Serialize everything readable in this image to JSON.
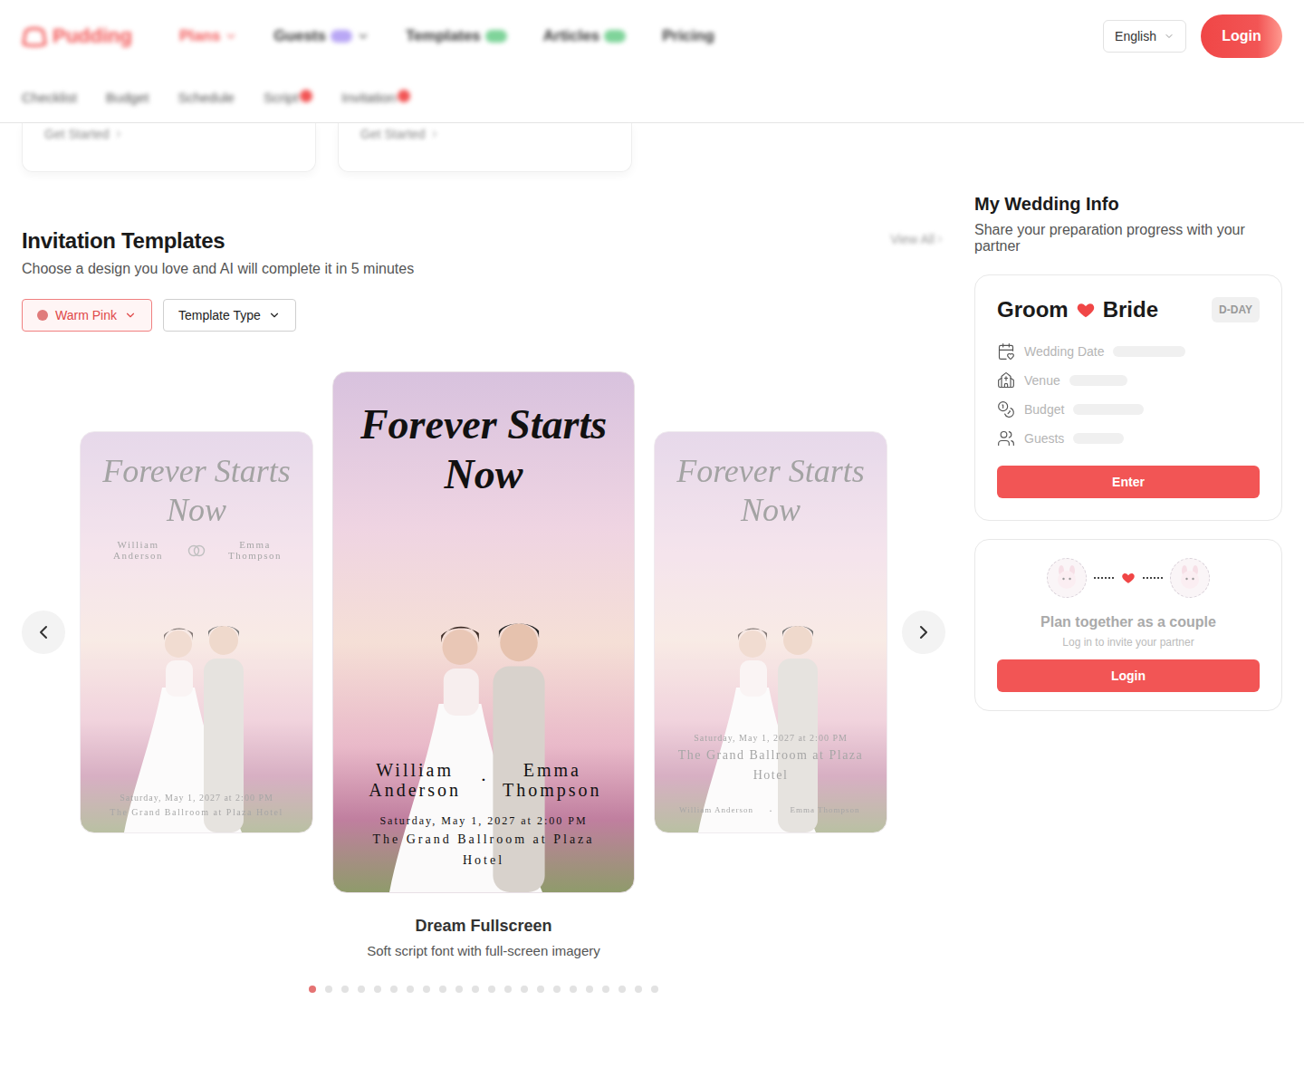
{
  "header": {
    "logo": "Pudding",
    "nav": [
      {
        "label": "Plans",
        "selected": true,
        "badge": false,
        "badge_color": "",
        "dropdown": true
      },
      {
        "label": "Guests",
        "selected": false,
        "badge": true,
        "badge_color": "#b9a7f5",
        "dropdown": true
      },
      {
        "label": "Templates",
        "selected": false,
        "badge": true,
        "badge_color": "#7fd49a",
        "dropdown": false
      },
      {
        "label": "Articles",
        "selected": false,
        "badge": true,
        "badge_color": "#7fd49a",
        "dropdown": false
      },
      {
        "label": "Pricing",
        "selected": false,
        "badge": false,
        "badge_color": "",
        "dropdown": false
      }
    ],
    "subnav": [
      {
        "label": "Checklist",
        "dot": false
      },
      {
        "label": "Budget",
        "dot": false
      },
      {
        "label": "Schedule",
        "dot": false
      },
      {
        "label": "Script",
        "dot": true
      },
      {
        "label": "Invitation",
        "dot": true
      }
    ],
    "language": "English",
    "login": "Login"
  },
  "feature_cards": [
    {
      "link": "Get Started"
    },
    {
      "link": "Get Started"
    }
  ],
  "invitations": {
    "title": "Invitation Templates",
    "subtitle": "Choose a design you love and AI will complete it in 5 minutes",
    "view_all": "View All",
    "filters": [
      {
        "label": "Warm Pink",
        "selected": true,
        "color": "#e07b7b"
      },
      {
        "label": "Template Type",
        "selected": false,
        "color": ""
      }
    ],
    "templates": [
      {
        "kind": "classic",
        "selected": false,
        "title": "Forever Starts Now",
        "groom": "William Anderson",
        "bride": "Emma Thompson",
        "separator": "",
        "date": "Saturday, May 1, 2027 at 2:00 PM",
        "venue": "The Grand Ballroom at Plaza Hotel"
      },
      {
        "kind": "fullscreen",
        "selected": true,
        "title": "Forever Starts Now",
        "groom": "William Anderson",
        "bride": "Emma Thompson",
        "separator": "·",
        "date": "Saturday, May 1, 2027 at 2:00 PM",
        "venue": "The Grand Ballroom at Plaza Hotel"
      },
      {
        "kind": "frame",
        "selected": false,
        "title": "Forever Starts Now",
        "groom": "William Anderson",
        "bride": "Emma Thompson",
        "separator": "·",
        "date": "Saturday, May 1, 2027 at 2:00 PM",
        "venue": "The Grand Ballroom at Plaza Hotel"
      }
    ],
    "caption": {
      "title": "Dream Fullscreen",
      "subtitle": "Soft script font with full-screen imagery"
    },
    "dots": [
      true,
      false,
      false,
      false,
      false,
      false,
      false,
      false,
      false,
      false,
      false,
      false,
      false,
      false,
      false,
      false,
      false,
      false,
      false,
      false,
      false,
      false
    ]
  },
  "wedding_info": {
    "title": "My Wedding Info",
    "subtitle": "Share your preparation progress with your partner",
    "groom": "Groom",
    "bride": "Bride",
    "badge": "D-DAY",
    "rows": [
      "Wedding Date",
      "Venue",
      "Budget",
      "Guests"
    ],
    "enter": "Enter"
  },
  "couple": {
    "title": "Plan together as a couple",
    "subtitle": "Log in to invite your partner",
    "login": "Login"
  }
}
